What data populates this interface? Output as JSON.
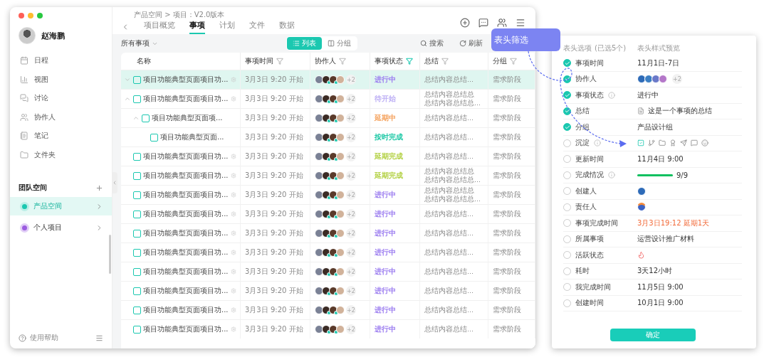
{
  "sidebar": {
    "user": {
      "name": "赵海鹏"
    },
    "nav_items": [
      {
        "label": "日程"
      },
      {
        "label": "视图"
      },
      {
        "label": "讨论"
      },
      {
        "label": "协作人"
      },
      {
        "label": "笔记"
      },
      {
        "label": "文件夹"
      }
    ],
    "team_section": {
      "title": "团队空间"
    },
    "spaces": [
      {
        "label": "产品空间",
        "selected": true,
        "color": "#1bc8b0"
      },
      {
        "label": "个人项目",
        "selected": false,
        "color": "#9b5ce0"
      }
    ],
    "help": "使用帮助"
  },
  "header": {
    "breadcrumb": "产品空间 > 项目：V2.0版本",
    "tabs": [
      {
        "label": "项目概览",
        "selected": false
      },
      {
        "label": "事项",
        "selected": true
      },
      {
        "label": "计划",
        "selected": false
      },
      {
        "label": "文件",
        "selected": false
      },
      {
        "label": "数据",
        "selected": false
      }
    ]
  },
  "toolbar": {
    "filter": "所有事项",
    "views": [
      {
        "label": "列表",
        "selected": true
      },
      {
        "label": "分组",
        "selected": false
      }
    ],
    "search": "搜索",
    "refresh": "刷新"
  },
  "table": {
    "columns": [
      {
        "label": "名称"
      },
      {
        "label": "事项时间",
        "filter_active": false
      },
      {
        "label": "协作人",
        "filter_active": false
      },
      {
        "label": "事项状态",
        "filter_active": true
      },
      {
        "label": "总结",
        "filter_active": false
      },
      {
        "label": "分组",
        "filter_active": false
      }
    ],
    "rows": [
      {
        "name": "项目功能典型页面项目功...",
        "expanded": false,
        "selected": true,
        "time": "3月3日 9:20 开始",
        "more": "+2",
        "status": "进行中",
        "color": "#9b7cf0",
        "summary": [
          "总结内容总结..."
        ],
        "group": "需求阶段"
      },
      {
        "name": "项目功能典型页面项目功...",
        "expanded": true,
        "selected": false,
        "time": "3月3日 9:20 开始",
        "more": "+2",
        "status": "待开始",
        "color": "#bcaef5",
        "summary": [
          "总结内容总结总",
          "总结内容总结总..."
        ],
        "group": "需求阶段",
        "children": [
          {
            "name": "项目功能典型页面项...",
            "expanded": true,
            "selected": false,
            "time": "3月3日 9:20 开始",
            "more": "+2",
            "status": "延期中",
            "color": "#f5a25d",
            "summary": [
              "总结内容总结..."
            ],
            "group": "需求阶段",
            "children": [
              {
                "name": "项目功能典型页面...",
                "selected": false,
                "time": "3月3日 9:20 开始",
                "more": "+2",
                "status": "按时完成",
                "color": "#1bc8a5",
                "summary": [
                  "总结内容总结..."
                ],
                "group": "需求阶段"
              }
            ]
          }
        ]
      },
      {
        "name": "项目功能典型页面项目功...",
        "selected": false,
        "time": "3月3日 9:20 开始",
        "more": "+2",
        "status": "延期完成",
        "color": "#b3d143",
        "summary": [
          "总结内容总结..."
        ],
        "group": "需求阶段"
      },
      {
        "name": "项目功能典型页面项目功...",
        "selected": false,
        "time": "3月3日 9:20 开始",
        "more": "+2",
        "status": "延期完成",
        "color": "#b3d143",
        "summary": [
          "总结内容总结总",
          "总结内容总结总..."
        ],
        "group": "需求阶段"
      },
      {
        "name": "项目功能典型页面项目功...",
        "selected": false,
        "time": "3月3日 9:20 开始",
        "more": "+2",
        "status": "进行中",
        "color": "#9b7cf0",
        "summary": [
          "总结内容总结总",
          "总结内容总结总..."
        ],
        "group": "需求阶段"
      },
      {
        "name": "项目功能典型页面项目功...",
        "selected": false,
        "time": "3月3日 9:20 开始",
        "more": "+2",
        "status": "进行中",
        "color": "#9b7cf0",
        "summary": [
          "总结内容总结..."
        ],
        "group": "需求阶段"
      },
      {
        "name": "项目功能典型页面项目功...",
        "selected": false,
        "time": "3月3日 9:20 开始",
        "more": "+2",
        "status": "进行中",
        "color": "#9b7cf0",
        "summary": [
          "总结内容总结..."
        ],
        "group": "需求阶段"
      },
      {
        "name": "项目功能典型页面项目功...",
        "selected": false,
        "time": "3月3日 9:20 开始",
        "more": "+2",
        "status": "进行中",
        "color": "#9b7cf0",
        "summary": [
          "总结内容总结..."
        ],
        "group": "需求阶段"
      },
      {
        "name": "项目功能典型页面项目功...",
        "selected": false,
        "time": "3月3日 9:20 开始",
        "more": "+2",
        "status": "进行中",
        "color": "#9b7cf0",
        "summary": [
          "总结内容总结..."
        ],
        "group": "需求阶段"
      },
      {
        "name": "项目功能典型页面项目功...",
        "selected": false,
        "time": "3月3日 9:20 开始",
        "more": "+2",
        "status": "进行中",
        "color": "#9b7cf0",
        "summary": [
          "总结内容总结..."
        ],
        "group": "需求阶段"
      },
      {
        "name": "项目功能典型页面项目功...",
        "selected": false,
        "time": "3月3日 9:20 开始",
        "more": "+2",
        "status": "进行中",
        "color": "#9b7cf0",
        "summary": [
          "总结内容总结..."
        ],
        "group": "需求阶段"
      },
      {
        "name": "项目功能典型页面项目功...",
        "selected": false,
        "time": "3月3日 9:20 开始",
        "more": "+2",
        "status": "进行中",
        "color": "#9b7cf0",
        "summary": [
          "总结内容总结..."
        ],
        "group": "需求阶段"
      }
    ]
  },
  "callout": {
    "text": "表头筛选"
  },
  "column_panel": {
    "title": "表头选项",
    "count": "(已选5个)",
    "preview_title": "表头样式预览",
    "options": [
      {
        "label": "事项时间",
        "checked": true,
        "info": false,
        "kind": "text",
        "value": "11月1日-7日"
      },
      {
        "label": "协作人",
        "checked": true,
        "info": false,
        "kind": "avatars",
        "value": "+2"
      },
      {
        "label": "事项状态",
        "checked": true,
        "info": true,
        "kind": "text",
        "value": "进行中"
      },
      {
        "label": "总结",
        "checked": true,
        "info": false,
        "kind": "note",
        "value": "这是一个事项的总结"
      },
      {
        "label": "分组",
        "checked": true,
        "info": false,
        "kind": "text",
        "value": "产品设计组"
      },
      {
        "label": "沉淀",
        "checked": false,
        "info": true,
        "kind": "icons"
      },
      {
        "label": "更新时间",
        "checked": false,
        "info": false,
        "kind": "text",
        "value": "11月4日 9:00"
      },
      {
        "label": "完成情况",
        "checked": false,
        "info": true,
        "kind": "progress",
        "level": 1,
        "value": "9/9"
      },
      {
        "label": "创建人",
        "checked": false,
        "info": false,
        "kind": "avatar"
      },
      {
        "label": "责任人",
        "checked": false,
        "info": false,
        "kind": "owner"
      },
      {
        "label": "事项完成时间",
        "checked": false,
        "info": false,
        "kind": "late",
        "value": "3月3日19:12 延期1天"
      },
      {
        "label": "所属事项",
        "checked": false,
        "info": false,
        "kind": "text",
        "value": "运营设计推广材料"
      },
      {
        "label": "活跃状态",
        "checked": false,
        "info": false,
        "kind": "flame"
      },
      {
        "label": "耗时",
        "checked": false,
        "info": false,
        "kind": "text",
        "value": "3天12小时"
      },
      {
        "label": "我完成时间",
        "checked": false,
        "info": false,
        "kind": "text",
        "value": "11月5日 9:00"
      },
      {
        "label": "创建时间",
        "checked": false,
        "info": false,
        "kind": "text",
        "value": "10月1日 9:00"
      }
    ],
    "confirm": "确定"
  }
}
